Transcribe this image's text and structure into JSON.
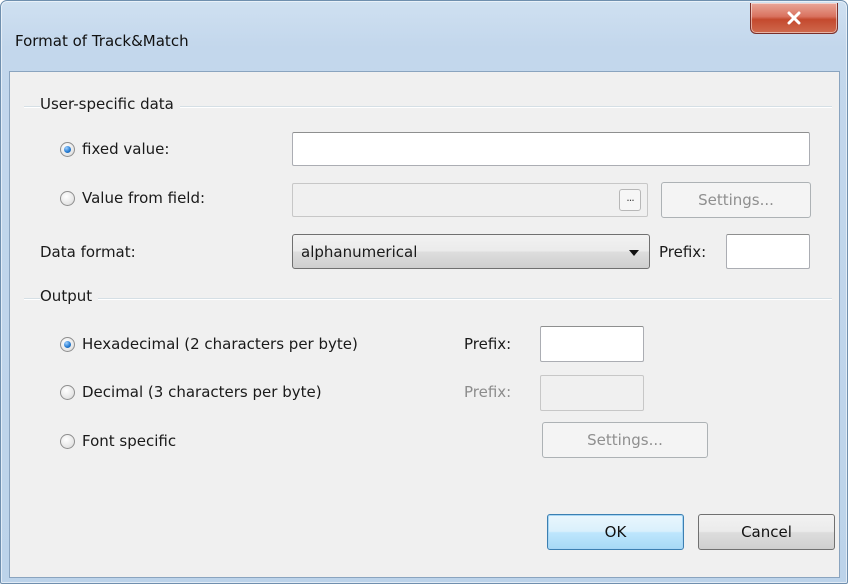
{
  "window": {
    "title": "Format of Track&Match",
    "close_label": "x"
  },
  "user_data": {
    "group_title": "User-specific data",
    "fixed_value_label": "fixed value:",
    "fixed_value_selected": true,
    "fixed_value_text": "",
    "value_from_field_label": "Value from field:",
    "value_from_field_selected": false,
    "value_from_field_text": "",
    "ellipsis_label": "···",
    "settings_label": "Settings...",
    "data_format_label": "Data format:",
    "data_format_value": "alphanumerical",
    "prefix_label": "Prefix:",
    "prefix_value": ""
  },
  "output": {
    "group_title": "Output",
    "hex_label": "Hexadecimal (2 characters per byte)",
    "hex_selected": true,
    "hex_prefix_label": "Prefix:",
    "hex_prefix_value": "",
    "decimal_label": "Decimal (3 characters per byte)",
    "decimal_selected": false,
    "decimal_prefix_label": "Prefix:",
    "decimal_prefix_value": "",
    "font_specific_label": "Font specific",
    "font_specific_selected": false,
    "settings_label": "Settings..."
  },
  "footer": {
    "ok_label": "OK",
    "cancel_label": "Cancel"
  },
  "colors": {
    "dialog_bg": "#f0f0f0",
    "frame": "#bcd3ea",
    "close_button": "#c4492e",
    "radio_selected": "#2a7fd4",
    "disabled_text": "#8c8c8c"
  }
}
